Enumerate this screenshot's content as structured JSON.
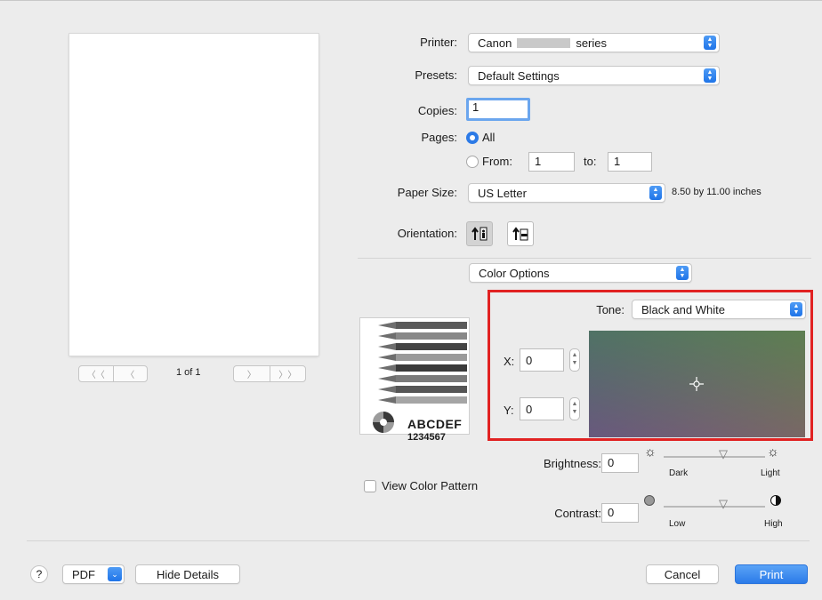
{
  "preview": {
    "page_indicator": "1 of 1"
  },
  "printer": {
    "label": "Printer:",
    "value": "Canon",
    "value_suffix": "series"
  },
  "presets": {
    "label": "Presets:",
    "value": "Default Settings"
  },
  "copies": {
    "label": "Copies:",
    "value": "1"
  },
  "pages": {
    "label": "Pages:",
    "all_label": "All",
    "from_label": "From:",
    "from_value": "1",
    "to_label": "to:",
    "to_value": "1",
    "selected": "All"
  },
  "paper_size": {
    "label": "Paper Size:",
    "value": "US Letter",
    "dimensions": "8.50 by 11.00 inches"
  },
  "orientation": {
    "label": "Orientation:",
    "selected": "portrait"
  },
  "section_popup": {
    "value": "Color Options"
  },
  "color_sample": {
    "text_line1": "ABCDEF",
    "text_line2": "1234567"
  },
  "tone": {
    "label": "Tone:",
    "value": "Black and White"
  },
  "x": {
    "label": "X:",
    "value": "0"
  },
  "y": {
    "label": "Y:",
    "value": "0"
  },
  "brightness": {
    "label": "Brightness:",
    "value": "0",
    "low_label": "Dark",
    "high_label": "Light"
  },
  "contrast": {
    "label": "Contrast:",
    "value": "0",
    "low_label": "Low",
    "high_label": "High"
  },
  "view_color_pattern": {
    "label": "View Color Pattern",
    "checked": false
  },
  "footer": {
    "help": "?",
    "pdf": "PDF",
    "hide_details": "Hide Details",
    "cancel": "Cancel",
    "print": "Print"
  },
  "colors": {
    "accent": "#2c7ae6",
    "highlight_border": "#e12222"
  }
}
